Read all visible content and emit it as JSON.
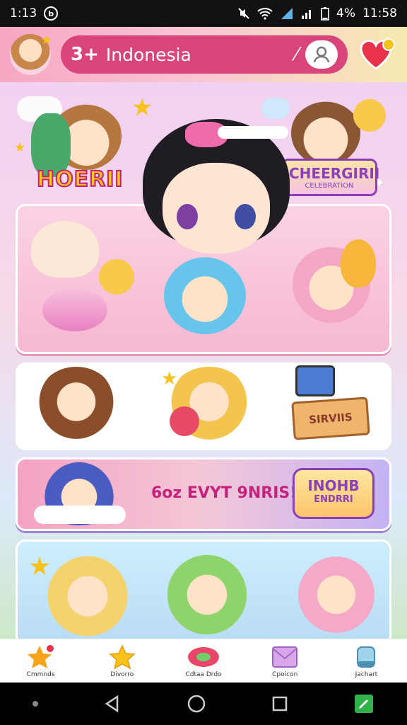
{
  "status_bar": {
    "time_left": "1:13",
    "battery": "4%",
    "time_right": "11:58"
  },
  "header": {
    "count": "3+",
    "title": "Indonesia"
  },
  "banners": {
    "logo_left": "HOERII",
    "logo_right_big": "CHEERGIRII",
    "logo_right_small": "CELEBRATION",
    "sign_board": "SIRVIIS",
    "promo_text": "6oz EVYT 9NRIS!",
    "badge_line1": "INOHB",
    "badge_line2": "ENDRRI"
  },
  "tabs": [
    {
      "label": "Cmmnds",
      "icon": "star-badge-icon"
    },
    {
      "label": "Divorro",
      "icon": "star-icon"
    },
    {
      "label": "Cdtaa Drdo",
      "icon": "gem-icon"
    },
    {
      "label": "Cpoicon",
      "icon": "envelope-icon"
    },
    {
      "label": "Jachart",
      "icon": "cup-icon"
    }
  ],
  "colors": {
    "accent": "#d9457a",
    "star": "#f6c21b",
    "purple": "#8b3fb8"
  }
}
